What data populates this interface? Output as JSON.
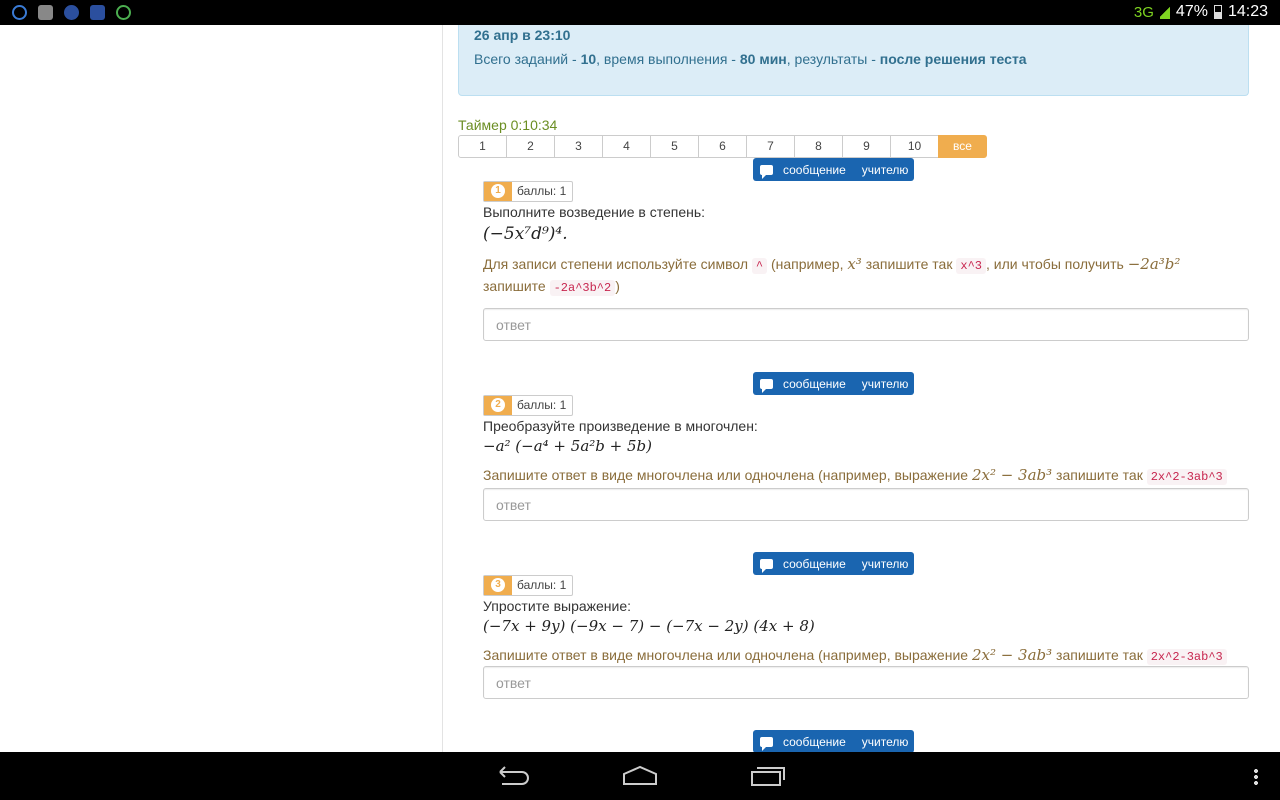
{
  "status_bar": {
    "network": "3G",
    "battery": "47%",
    "time": "14:23"
  },
  "info": {
    "date": "26 апр в 23:10",
    "tasks_label": "Всего заданий - ",
    "tasks_value": "10",
    "time_label": ", время выполнения - ",
    "time_value": "80 мин",
    "results_label": ", результаты - ",
    "results_value": "после решения теста"
  },
  "timer": "Таймер 0:10:34",
  "pager": [
    "1",
    "2",
    "3",
    "4",
    "5",
    "6",
    "7",
    "8",
    "9",
    "10",
    "все"
  ],
  "message_button": {
    "word1": "сообщение",
    "word2": "учителю"
  },
  "questions": [
    {
      "number": "1",
      "points": "баллы: 1",
      "text": "Выполните возведение в степень:",
      "expression": "(−5x⁷d⁹)⁴.",
      "hint": {
        "p1": "Для записи степени используйте символ ",
        "c1": "^",
        "p2": " (например, ",
        "m1": "x³",
        "p3": " запишите так ",
        "c2": "x^3",
        "p4": ", или чтобы получить ",
        "m2": "−2a³b²",
        "p5": "запишите ",
        "c3": "-2a^3b^2",
        "p6": ")"
      },
      "answer_placeholder": "ответ"
    },
    {
      "number": "2",
      "points": "баллы: 1",
      "text": "Преобразуйте произведение в многочлен:",
      "expression": "−a² (−a⁴ + 5a²b + 5b)",
      "hint": {
        "p1": "Запишите ответ в виде многочлена или одночлена (например, выражение ",
        "m1": "2x² − 3ab³",
        "p2": " запишите так ",
        "c1": "2x^2-3ab^3"
      },
      "answer_placeholder": "ответ"
    },
    {
      "number": "3",
      "points": "баллы: 1",
      "text": "Упростите выражение:",
      "expression": "(−7x + 9y) (−9x − 7) − (−7x − 2y) (4x + 8)",
      "hint": {
        "p1": "Запишите ответ в виде многочлена или одночлена (например, выражение ",
        "m1": "2x² − 3ab³",
        "p2": " запишите так ",
        "c1": "2x^2-3ab^3"
      },
      "answer_placeholder": "ответ"
    }
  ]
}
